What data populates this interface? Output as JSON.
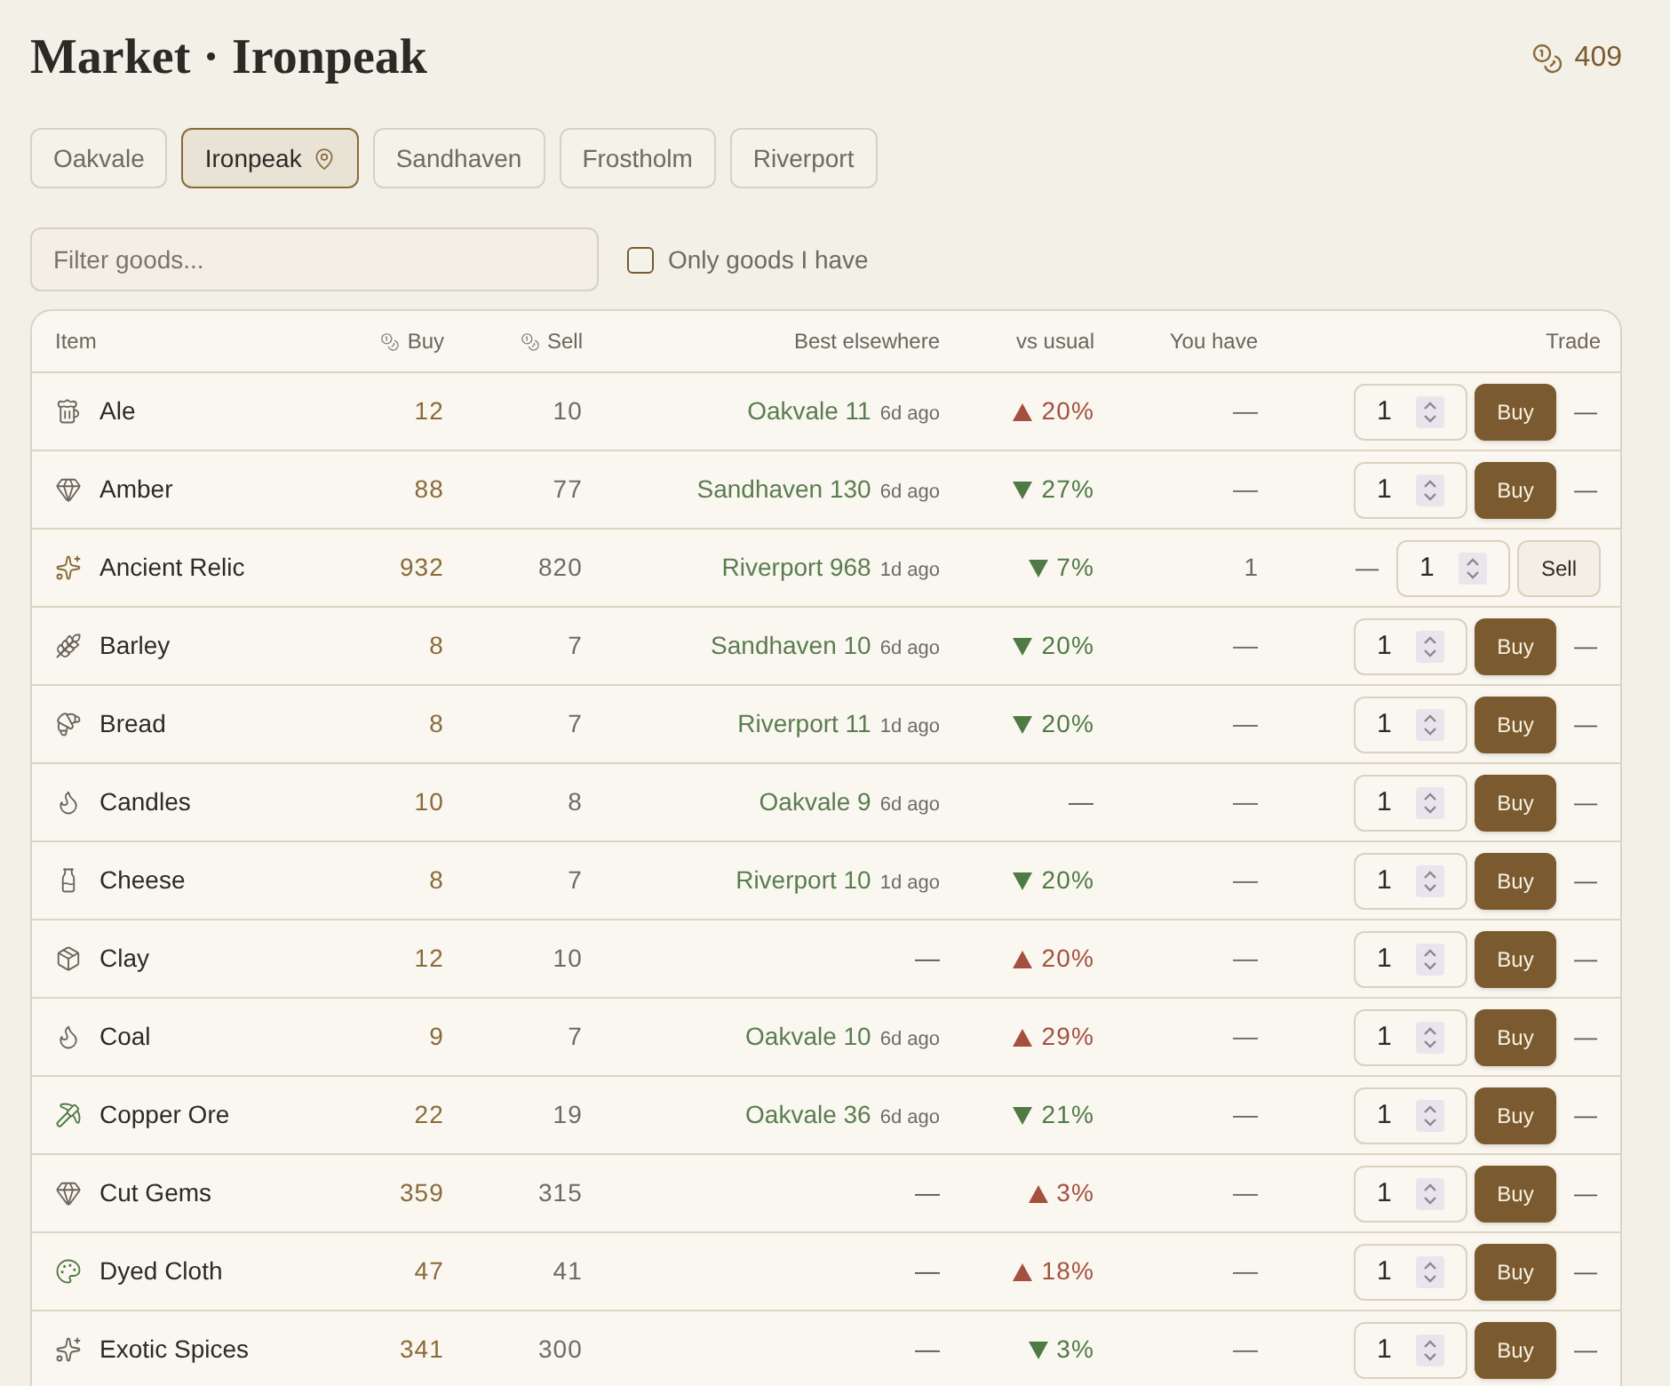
{
  "header": {
    "title": "Market · Ironpeak",
    "coins": "409"
  },
  "towns": [
    {
      "name": "Oakvale",
      "selected": false,
      "current": false
    },
    {
      "name": "Ironpeak",
      "selected": true,
      "current": true
    },
    {
      "name": "Sandhaven",
      "selected": false,
      "current": false
    },
    {
      "name": "Frostholm",
      "selected": false,
      "current": false
    },
    {
      "name": "Riverport",
      "selected": false,
      "current": false
    }
  ],
  "filter": {
    "placeholder": "Filter goods..."
  },
  "only_owned": {
    "label": "Only goods I have",
    "checked": false
  },
  "table": {
    "columns": [
      "Item",
      "Buy",
      "Sell",
      "Best elsewhere",
      "vs usual",
      "You have",
      "Trade"
    ],
    "rows": [
      {
        "kind": "drink",
        "color": "#6b655c",
        "name": "Ale",
        "buy": "12",
        "sell": "10",
        "best": {
          "kind": "offer",
          "place": "Oakvale 11",
          "age": "6d ago"
        },
        "trend": {
          "kind": "up",
          "text": "20%"
        },
        "have": "—",
        "trade": [
          {
            "kind": "quantity",
            "value": "1"
          },
          {
            "kind": "buy",
            "label": "Buy"
          },
          {
            "kind": "dash",
            "text": "—"
          }
        ]
      },
      {
        "kind": "gem",
        "color": "#6b655c",
        "name": "Amber",
        "buy": "88",
        "sell": "77",
        "best": {
          "kind": "offer",
          "place": "Sandhaven 130",
          "age": "6d ago"
        },
        "trend": {
          "kind": "down",
          "text": "27%"
        },
        "have": "—",
        "trade": [
          {
            "kind": "quantity",
            "value": "1"
          },
          {
            "kind": "buy",
            "label": "Buy"
          },
          {
            "kind": "dash",
            "text": "—"
          }
        ]
      },
      {
        "kind": "relic",
        "color": "#8a6a3a",
        "name": "Ancient Relic",
        "buy": "932",
        "sell": "820",
        "best": {
          "kind": "offer",
          "place": "Riverport 968",
          "age": "1d ago"
        },
        "trend": {
          "kind": "down",
          "text": "7%"
        },
        "have": "1",
        "trade": [
          {
            "kind": "dash",
            "text": "—"
          },
          {
            "kind": "quantity",
            "value": "1"
          },
          {
            "kind": "sell",
            "label": "Sell"
          }
        ]
      },
      {
        "kind": "grain",
        "color": "#6b655c",
        "name": "Barley",
        "buy": "8",
        "sell": "7",
        "best": {
          "kind": "offer",
          "place": "Sandhaven 10",
          "age": "6d ago"
        },
        "trend": {
          "kind": "down",
          "text": "20%"
        },
        "have": "—",
        "trade": [
          {
            "kind": "quantity",
            "value": "1"
          },
          {
            "kind": "buy",
            "label": "Buy"
          },
          {
            "kind": "dash",
            "text": "—"
          }
        ]
      },
      {
        "kind": "baked",
        "color": "#6b655c",
        "name": "Bread",
        "buy": "8",
        "sell": "7",
        "best": {
          "kind": "offer",
          "place": "Riverport 11",
          "age": "1d ago"
        },
        "trend": {
          "kind": "down",
          "text": "20%"
        },
        "have": "—",
        "trade": [
          {
            "kind": "quantity",
            "value": "1"
          },
          {
            "kind": "buy",
            "label": "Buy"
          },
          {
            "kind": "dash",
            "text": "—"
          }
        ]
      },
      {
        "kind": "fuel",
        "color": "#6b655c",
        "name": "Candles",
        "buy": "10",
        "sell": "8",
        "best": {
          "kind": "offer",
          "place": "Oakvale 9",
          "age": "6d ago"
        },
        "trend": {
          "kind": "none",
          "text": "—"
        },
        "have": "—",
        "trade": [
          {
            "kind": "quantity",
            "value": "1"
          },
          {
            "kind": "buy",
            "label": "Buy"
          },
          {
            "kind": "dash",
            "text": "—"
          }
        ]
      },
      {
        "kind": "dairy",
        "color": "#6b655c",
        "name": "Cheese",
        "buy": "8",
        "sell": "7",
        "best": {
          "kind": "offer",
          "place": "Riverport 10",
          "age": "1d ago"
        },
        "trend": {
          "kind": "down",
          "text": "20%"
        },
        "have": "—",
        "trade": [
          {
            "kind": "quantity",
            "value": "1"
          },
          {
            "kind": "buy",
            "label": "Buy"
          },
          {
            "kind": "dash",
            "text": "—"
          }
        ]
      },
      {
        "kind": "material",
        "color": "#6b655c",
        "name": "Clay",
        "buy": "12",
        "sell": "10",
        "best": {
          "kind": "none",
          "text": "—"
        },
        "trend": {
          "kind": "up",
          "text": "20%"
        },
        "have": "—",
        "trade": [
          {
            "kind": "quantity",
            "value": "1"
          },
          {
            "kind": "buy",
            "label": "Buy"
          },
          {
            "kind": "dash",
            "text": "—"
          }
        ]
      },
      {
        "kind": "fuel",
        "color": "#6b655c",
        "name": "Coal",
        "buy": "9",
        "sell": "7",
        "best": {
          "kind": "offer",
          "place": "Oakvale 10",
          "age": "6d ago"
        },
        "trend": {
          "kind": "up",
          "text": "29%"
        },
        "have": "—",
        "trade": [
          {
            "kind": "quantity",
            "value": "1"
          },
          {
            "kind": "buy",
            "label": "Buy"
          },
          {
            "kind": "dash",
            "text": "—"
          }
        ]
      },
      {
        "kind": "ore",
        "color": "#4f7a44",
        "name": "Copper Ore",
        "buy": "22",
        "sell": "19",
        "best": {
          "kind": "offer",
          "place": "Oakvale 36",
          "age": "6d ago"
        },
        "trend": {
          "kind": "down",
          "text": "21%"
        },
        "have": "—",
        "trade": [
          {
            "kind": "quantity",
            "value": "1"
          },
          {
            "kind": "buy",
            "label": "Buy"
          },
          {
            "kind": "dash",
            "text": "—"
          }
        ]
      },
      {
        "kind": "gem",
        "color": "#6b655c",
        "name": "Cut Gems",
        "buy": "359",
        "sell": "315",
        "best": {
          "kind": "none",
          "text": "—"
        },
        "trend": {
          "kind": "up",
          "text": "3%"
        },
        "have": "—",
        "trade": [
          {
            "kind": "quantity",
            "value": "1"
          },
          {
            "kind": "buy",
            "label": "Buy"
          },
          {
            "kind": "dash",
            "text": "—"
          }
        ]
      },
      {
        "kind": "textile",
        "color": "#4f7a44",
        "name": "Dyed Cloth",
        "buy": "47",
        "sell": "41",
        "best": {
          "kind": "none",
          "text": "—"
        },
        "trend": {
          "kind": "up",
          "text": "18%"
        },
        "have": "—",
        "trade": [
          {
            "kind": "quantity",
            "value": "1"
          },
          {
            "kind": "buy",
            "label": "Buy"
          },
          {
            "kind": "dash",
            "text": "—"
          }
        ]
      },
      {
        "kind": "spice",
        "color": "#6b655c",
        "name": "Exotic Spices",
        "buy": "341",
        "sell": "300",
        "best": {
          "kind": "none",
          "text": "—"
        },
        "trend": {
          "kind": "down",
          "text": "3%"
        },
        "have": "—",
        "trade": [
          {
            "kind": "quantity",
            "value": "1"
          },
          {
            "kind": "buy",
            "label": "Buy"
          },
          {
            "kind": "dash",
            "text": "—"
          }
        ]
      }
    ]
  }
}
